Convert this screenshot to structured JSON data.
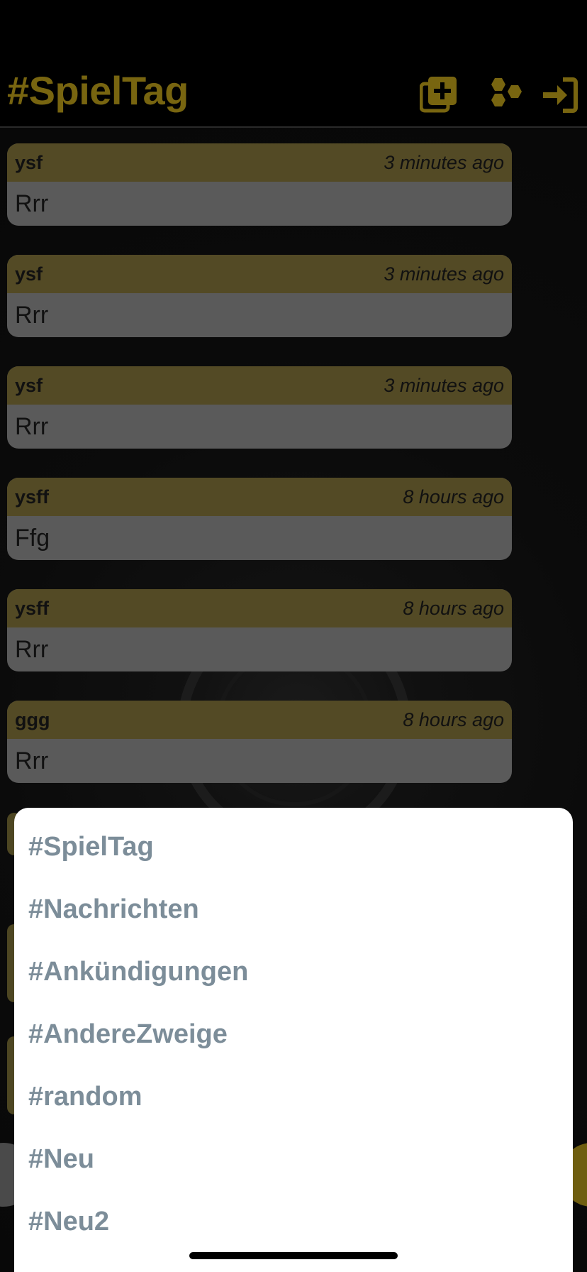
{
  "header": {
    "title": "#SpielTag",
    "icons": [
      "add-channel-icon",
      "hexagons-icon",
      "logout-icon"
    ],
    "accent_color": "#786510"
  },
  "messages": [
    {
      "user": "ysf",
      "time": "3 minutes ago",
      "text": "Rrr"
    },
    {
      "user": "ysf",
      "time": "3 minutes ago",
      "text": "Rrr"
    },
    {
      "user": "ysf",
      "time": "3 minutes ago",
      "text": "Rrr"
    },
    {
      "user": "ysff",
      "time": "8 hours ago",
      "text": "Ffg"
    },
    {
      "user": "ysff",
      "time": "8 hours ago",
      "text": "Rrr"
    },
    {
      "user": "ggg",
      "time": "8 hours ago",
      "text": "Rrr"
    }
  ],
  "channel_menu": {
    "items": [
      "#SpielTag",
      "#Nachrichten",
      "#Ankündigungen",
      "#AndereZweige",
      "#random",
      "#Neu",
      "#Neu2"
    ],
    "text_color": "#7c8d99"
  }
}
